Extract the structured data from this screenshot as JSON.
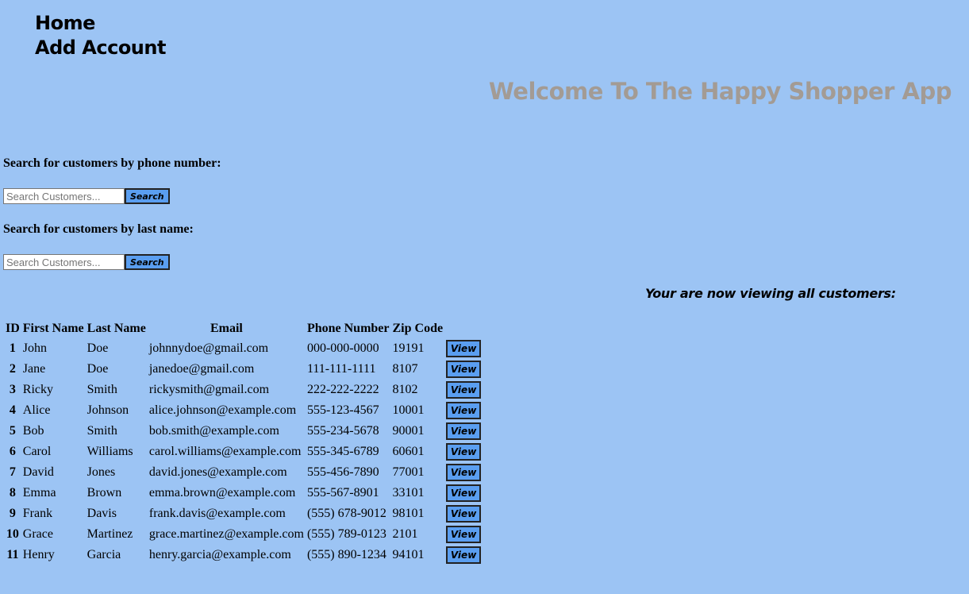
{
  "nav": {
    "items": [
      {
        "label": "Home"
      },
      {
        "label": "Add Account"
      }
    ]
  },
  "header": {
    "welcome": "Welcome To The Happy Shopper App"
  },
  "search_phone": {
    "label": "Search for customers by phone number:",
    "placeholder": "Search Customers...",
    "value": "",
    "button_label": "Search"
  },
  "search_lastname": {
    "label": "Search for customers by last name:",
    "placeholder": "Search Customers...",
    "value": "",
    "button_label": "Search"
  },
  "viewing_text": "Your are now viewing all customers:",
  "table": {
    "headers": [
      "ID",
      "First Name",
      "Last Name",
      "Email",
      "Phone Number",
      "Zip Code"
    ],
    "view_label": "View",
    "rows": [
      {
        "id": "1",
        "first": "John",
        "last": "Doe",
        "email": "johnnydoe@gmail.com",
        "phone": "000-000-0000",
        "zip": "19191"
      },
      {
        "id": "2",
        "first": "Jane",
        "last": "Doe",
        "email": "janedoe@gmail.com",
        "phone": "111-111-1111",
        "zip": "8107"
      },
      {
        "id": "3",
        "first": "Ricky",
        "last": "Smith",
        "email": "rickysmith@gmail.com",
        "phone": "222-222-2222",
        "zip": "8102"
      },
      {
        "id": "4",
        "first": "Alice",
        "last": "Johnson",
        "email": "alice.johnson@example.com",
        "phone": "555-123-4567",
        "zip": "10001"
      },
      {
        "id": "5",
        "first": "Bob",
        "last": "Smith",
        "email": "bob.smith@example.com",
        "phone": "555-234-5678",
        "zip": "90001"
      },
      {
        "id": "6",
        "first": "Carol",
        "last": "Williams",
        "email": "carol.williams@example.com",
        "phone": "555-345-6789",
        "zip": "60601"
      },
      {
        "id": "7",
        "first": "David",
        "last": "Jones",
        "email": "david.jones@example.com",
        "phone": "555-456-7890",
        "zip": "77001"
      },
      {
        "id": "8",
        "first": "Emma",
        "last": "Brown",
        "email": "emma.brown@example.com",
        "phone": "555-567-8901",
        "zip": "33101"
      },
      {
        "id": "9",
        "first": "Frank",
        "last": "Davis",
        "email": "frank.davis@example.com",
        "phone": "(555) 678-9012",
        "zip": "98101"
      },
      {
        "id": "10",
        "first": "Grace",
        "last": "Martinez",
        "email": "grace.martinez@example.com",
        "phone": "(555) 789-0123",
        "zip": "2101"
      },
      {
        "id": "11",
        "first": "Henry",
        "last": "Garcia",
        "email": "henry.garcia@example.com",
        "phone": "(555) 890-1234",
        "zip": "94101"
      }
    ]
  },
  "colors": {
    "background": "#9cc4f4",
    "button": "#5a9ef0",
    "welcome_text": "#a39b94"
  }
}
